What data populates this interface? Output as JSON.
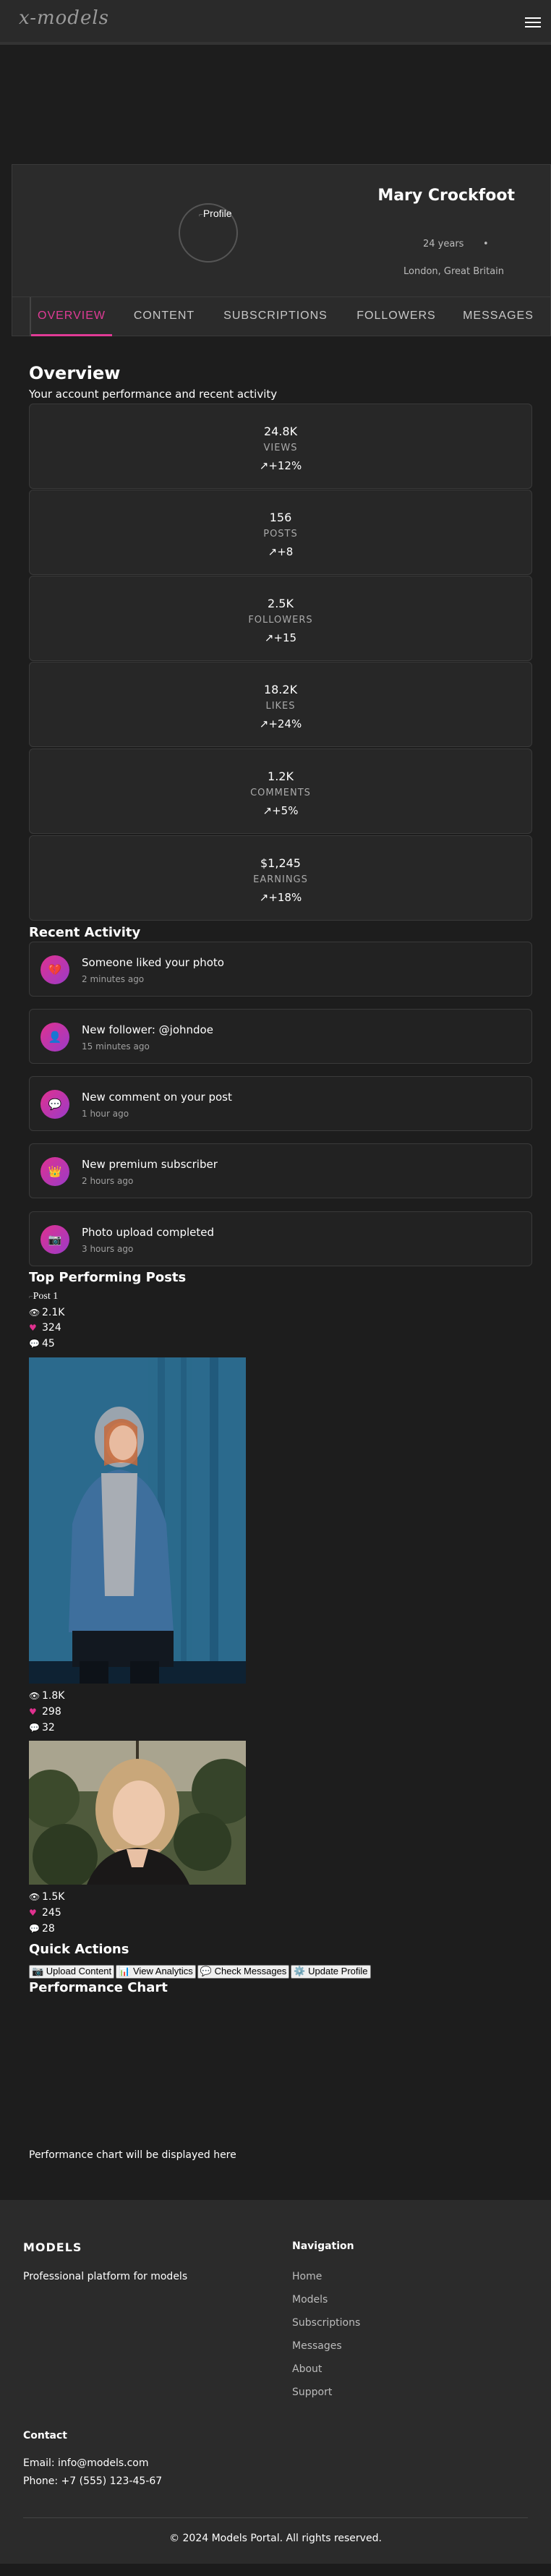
{
  "header": {
    "logo": "x-models"
  },
  "profile": {
    "avatar_alt": "Profile",
    "name": "Mary Crockfoot",
    "age": "24 years",
    "separator": "•",
    "location": "London, Great Britain"
  },
  "tabs": [
    {
      "label": "OVERVIEW",
      "active": true
    },
    {
      "label": "CONTENT",
      "active": false
    },
    {
      "label": "SUBSCRIPTIONS",
      "active": false
    },
    {
      "label": "FOLLOWERS",
      "active": false
    },
    {
      "label": "MESSAGES",
      "active": false
    }
  ],
  "overview": {
    "title": "Overview",
    "subtitle": "Your account performance and recent activity",
    "stats": [
      {
        "value": "24.8K",
        "label": "VIEWS",
        "change": "↗+12%"
      },
      {
        "value": "156",
        "label": "POSTS",
        "change": "↗+8"
      },
      {
        "value": "2.5K",
        "label": "FOLLOWERS",
        "change": "↗+15"
      },
      {
        "value": "18.2K",
        "label": "LIKES",
        "change": "↗+24%"
      },
      {
        "value": "1.2K",
        "label": "COMMENTS",
        "change": "↗+5%"
      },
      {
        "value": "$1,245",
        "label": "EARNINGS",
        "change": "↗+18%"
      }
    ]
  },
  "recent_activity": {
    "title": "Recent Activity",
    "items": [
      {
        "icon": "heart-icon",
        "glyph": "💔",
        "title": "Someone liked your photo",
        "time": "2 minutes ago"
      },
      {
        "icon": "user-icon",
        "glyph": "👤",
        "title": "New follower: @johndoe",
        "time": "15 minutes ago"
      },
      {
        "icon": "comment-icon",
        "glyph": "💬",
        "title": "New comment on your post",
        "time": "1 hour ago"
      },
      {
        "icon": "crown-icon",
        "glyph": "👑",
        "title": "New premium subscriber",
        "time": "2 hours ago"
      },
      {
        "icon": "camera-icon",
        "glyph": "📷",
        "title": "Photo upload completed",
        "time": "3 hours ago"
      }
    ]
  },
  "top_posts": {
    "title": "Top Performing Posts",
    "posts": [
      {
        "alt": "Post 1",
        "views": "2.1K",
        "likes": "324",
        "comments": "45"
      },
      {
        "views": "1.8K",
        "likes": "298",
        "comments": "32"
      },
      {
        "views": "1.5K",
        "likes": "245",
        "comments": "28"
      }
    ]
  },
  "quick_actions": {
    "title": "Quick Actions",
    "buttons": [
      {
        "label": "📷 Upload Content"
      },
      {
        "label": "📊 View Analytics"
      },
      {
        "label": "💬 Check Messages"
      },
      {
        "label": "⚙️ Update Profile"
      }
    ]
  },
  "performance_chart": {
    "title": "Performance Chart",
    "placeholder": "Performance chart will be displayed here"
  },
  "footer": {
    "brand": "MODELS",
    "tagline": "Professional platform for models",
    "nav_title": "Navigation",
    "nav_links": [
      "Home",
      "Models",
      "Subscriptions",
      "Messages",
      "About",
      "Support"
    ],
    "contact_title": "Contact",
    "email": "Email: info@models.com",
    "phone": "Phone: +7 (555) 123-45-67",
    "copyright": "© 2024 Models Portal. All rights reserved."
  },
  "colors": {
    "accent": "#e03b96",
    "background": "#1d1d1d",
    "card": "#272727"
  }
}
